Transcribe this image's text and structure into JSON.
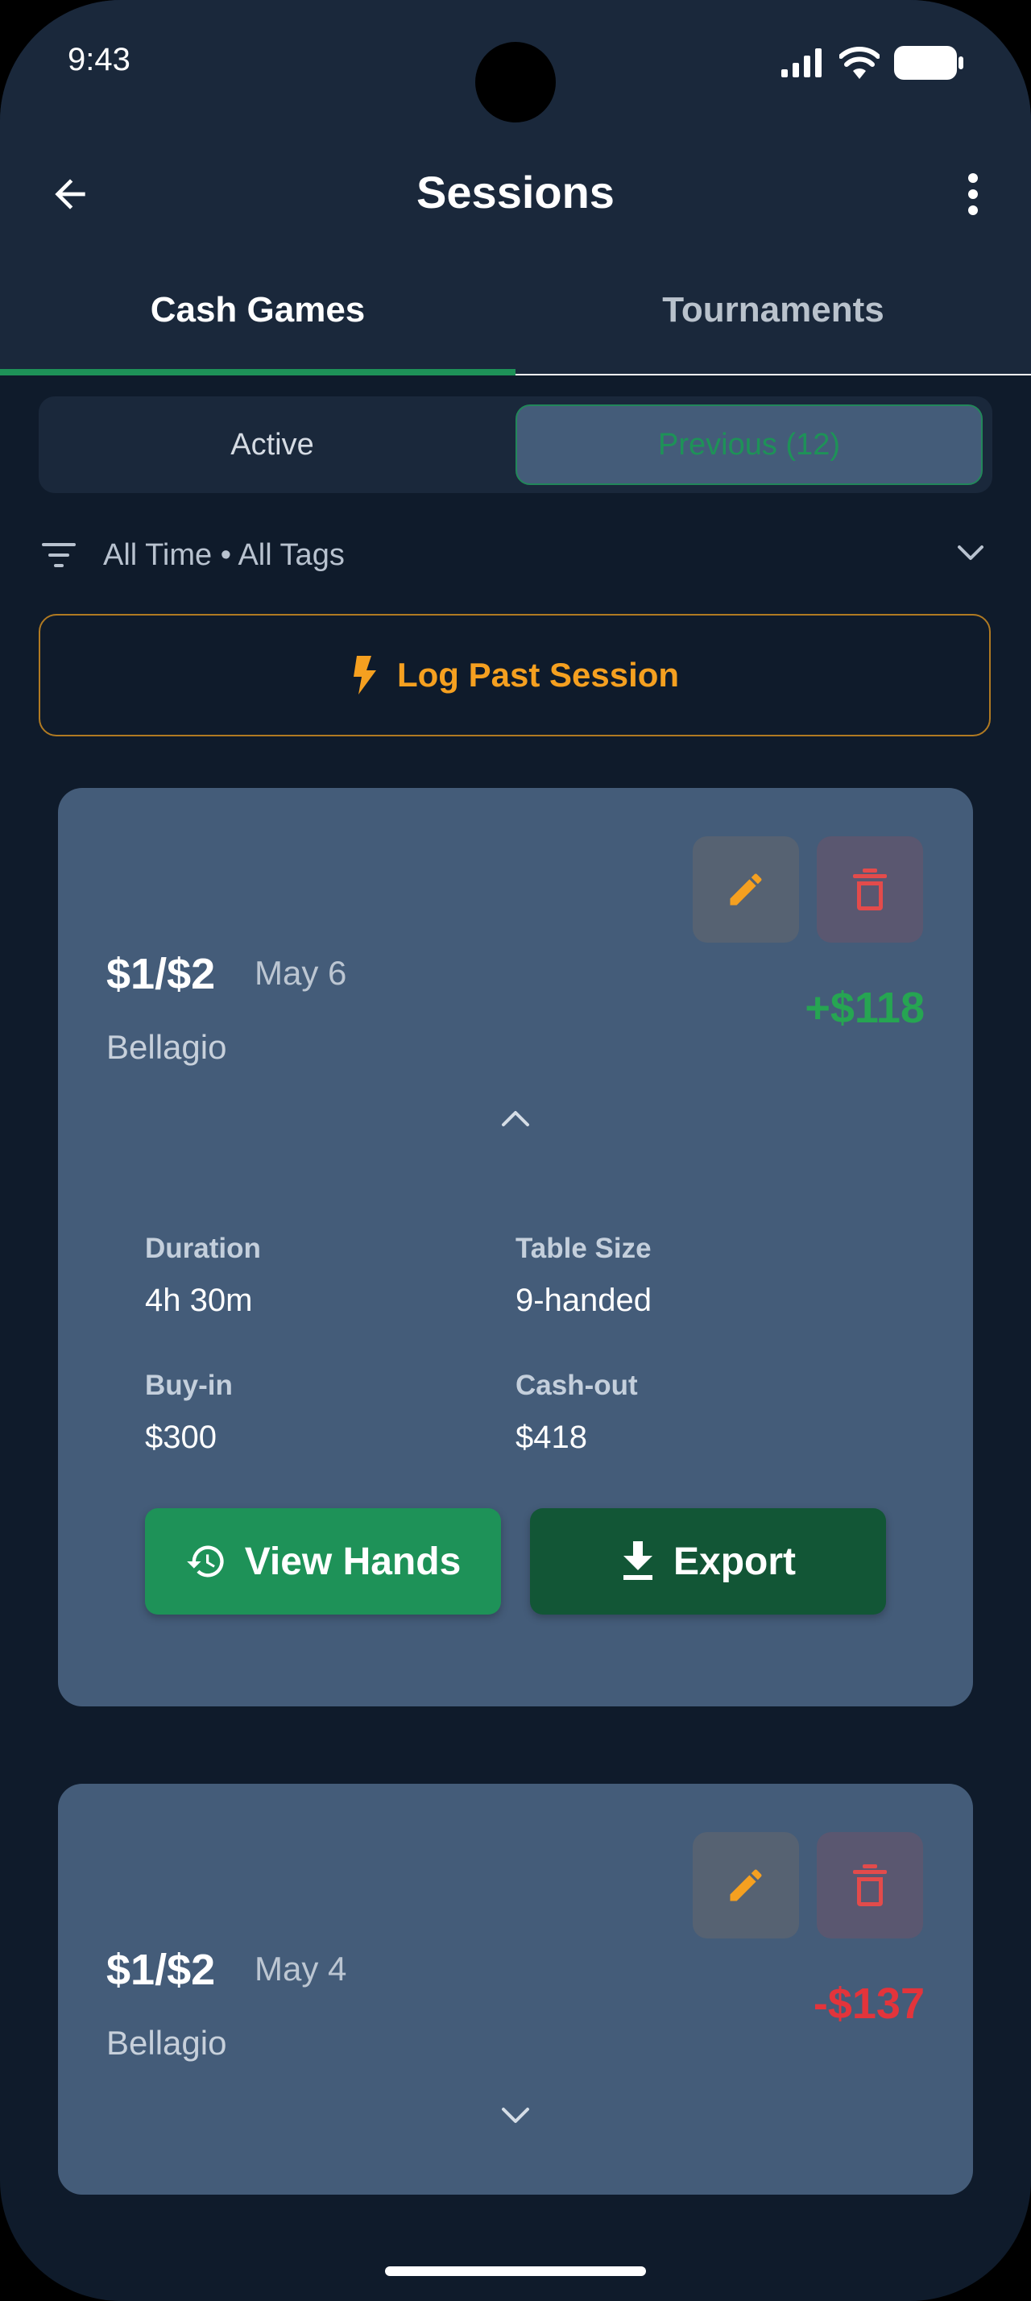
{
  "status_bar": {
    "time": "9:43"
  },
  "app_bar": {
    "title": "Sessions"
  },
  "tabs": [
    {
      "label": "Cash Games",
      "selected": true
    },
    {
      "label": "Tournaments",
      "selected": false
    }
  ],
  "segments": {
    "active_label": "Active",
    "previous_label": "Previous (12)",
    "selected": "previous"
  },
  "filter": {
    "summary": "All Time • All Tags"
  },
  "log_button": {
    "label": "Log Past Session"
  },
  "sessions": [
    {
      "stakes": "$1/$2",
      "date": "May 6",
      "venue": "Bellagio",
      "result": "+$118",
      "expanded": true,
      "details": {
        "duration_label": "Duration",
        "duration": "4h 30m",
        "table_size_label": "Table Size",
        "table_size": "9-handed",
        "buyin_label": "Buy-in",
        "buyin": "$300",
        "cashout_label": "Cash-out",
        "cashout": "$418"
      },
      "actions": {
        "view_hands": "View Hands",
        "export": "Export"
      }
    },
    {
      "stakes": "$1/$2",
      "date": "May 4",
      "venue": "Bellagio",
      "result": "-$137",
      "expanded": false
    }
  ],
  "colors": {
    "accent_green": "#1e9258",
    "accent_orange": "#f5a020",
    "profit_positive": "#26a552",
    "profit_negative": "#e3343b",
    "card_bg": "#445c79",
    "page_bg": "#0f1b2b"
  }
}
